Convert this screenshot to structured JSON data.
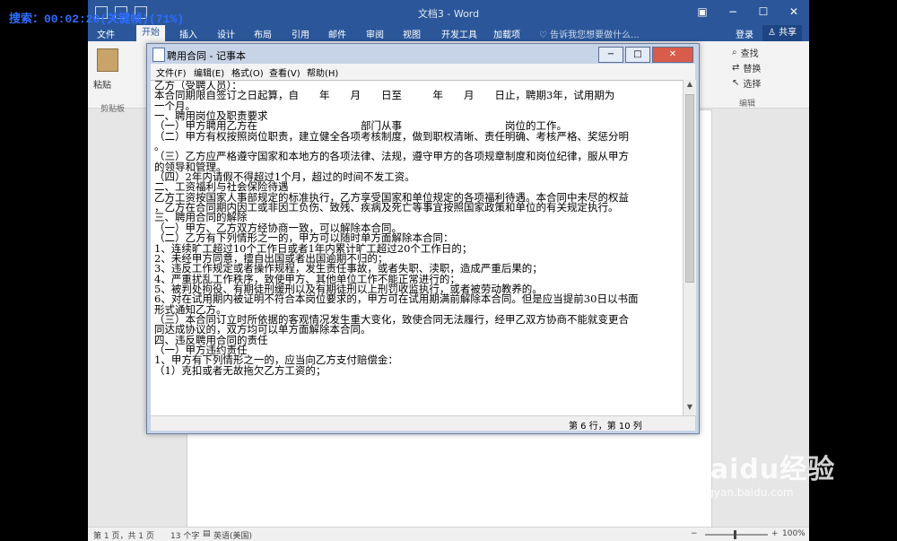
{
  "overlay": {
    "search_text": "搜索：00:02:20(关键帧)(71%)"
  },
  "word": {
    "title": "文档3 - Word",
    "tabs": [
      "文件",
      "开始",
      "插入",
      "设计",
      "布局",
      "引用",
      "邮件",
      "审阅",
      "视图",
      "开发工具",
      "加载项"
    ],
    "tell_me": "告诉我您想要做什么...",
    "login": "登录",
    "share": "共享",
    "clipboard": {
      "paste": "粘贴",
      "group_label": "剪贴板"
    },
    "editing": {
      "find": "查找",
      "replace": "替换",
      "select": "选择",
      "group_label": "编辑"
    },
    "status": {
      "page": "第 1 页，共 1 页",
      "words": "13 个字",
      "lang": "英语(美国)",
      "zoom": "100%"
    }
  },
  "notepad": {
    "title": "聘用合同 - 记事本",
    "menu": [
      "文件(F)",
      "编辑(E)",
      "格式(O)",
      "查看(V)",
      "帮助(H)"
    ],
    "lines": [
      "乙方（受聘人员）：",
      "本合同期限自签订之日起算，自　　年　　月　　日至　　　年　　月　　日止，聘期3年，试用期为",
      "一个月。",
      "一、聘用岗位及职责要求",
      "（一）甲方聘用乙方在　　　　　　　　　　部门从事　　　　　　　　　　岗位的工作。",
      "（二）甲方有权按照岗位职责，建立健全各项考核制度，做到职权清晰、责任明确、考核严格、奖惩分明",
      "。",
      "（三）乙方应严格遵守国家和本地方的各项法律、法规，遵守甲方的各项规章制度和岗位纪律，服从甲方",
      "的领导和管理。",
      "（四）2年内请假不得超过1个月，超过的时间不发工资。",
      "二、工资福利与社会保险待遇",
      "乙方工资按国家人事部规定的标准执行，乙方享受国家和单位规定的各项福利待遇。本合同中未尽的权益",
      "，乙方在合同期内因工或非因工负伤、致残、疾病及死亡等事宜按照国家政策和单位的有关规定执行。",
      "三、聘用合同的解除",
      "（一）甲方、乙方双方经协商一致，可以解除本合同。",
      "（二）乙方有下列情形之一的，甲方可以随时单方面解除本合同：",
      "1、连续旷工超过10个工作日或者1年内累计旷工超过20个工作日的；",
      "2、未经甲方同意，擅自出国或者出国逾期不归的；",
      "3、违反工作规定或者操作规程，发生责任事故，或者失职、渎职，造成严重后果的；",
      "4、严重扰乱工作秩序，致使甲方、其他单位工作不能正常进行的；",
      "5、被判处拘役、有期徒刑缓刑以及有期徒刑以上刑罚收监执行，或者被劳动教养的。",
      "6、对在试用期内被证明不符合本岗位要求的，甲方可在试用期满前解除本合同。但是应当提前30日以书面",
      "形式通知乙方。",
      "（三）本合同订立时所依据的客观情况发生重大变化，致使合同无法履行，经甲乙双方协商不能就变更合",
      "同达成协议的，双方均可以单方面解除本合同。",
      "四、违反聘用合同的责任",
      "（一）甲方违约责任",
      "1、甲方有下列情形之一的，应当向乙方支付赔偿金：",
      "（1）克扣或者无故拖欠乙方工资的；"
    ],
    "status_pos": "第 6 行，第 10 列"
  },
  "watermark": {
    "main": "Baidu经验",
    "sub": "jingyan.baidu.com"
  }
}
